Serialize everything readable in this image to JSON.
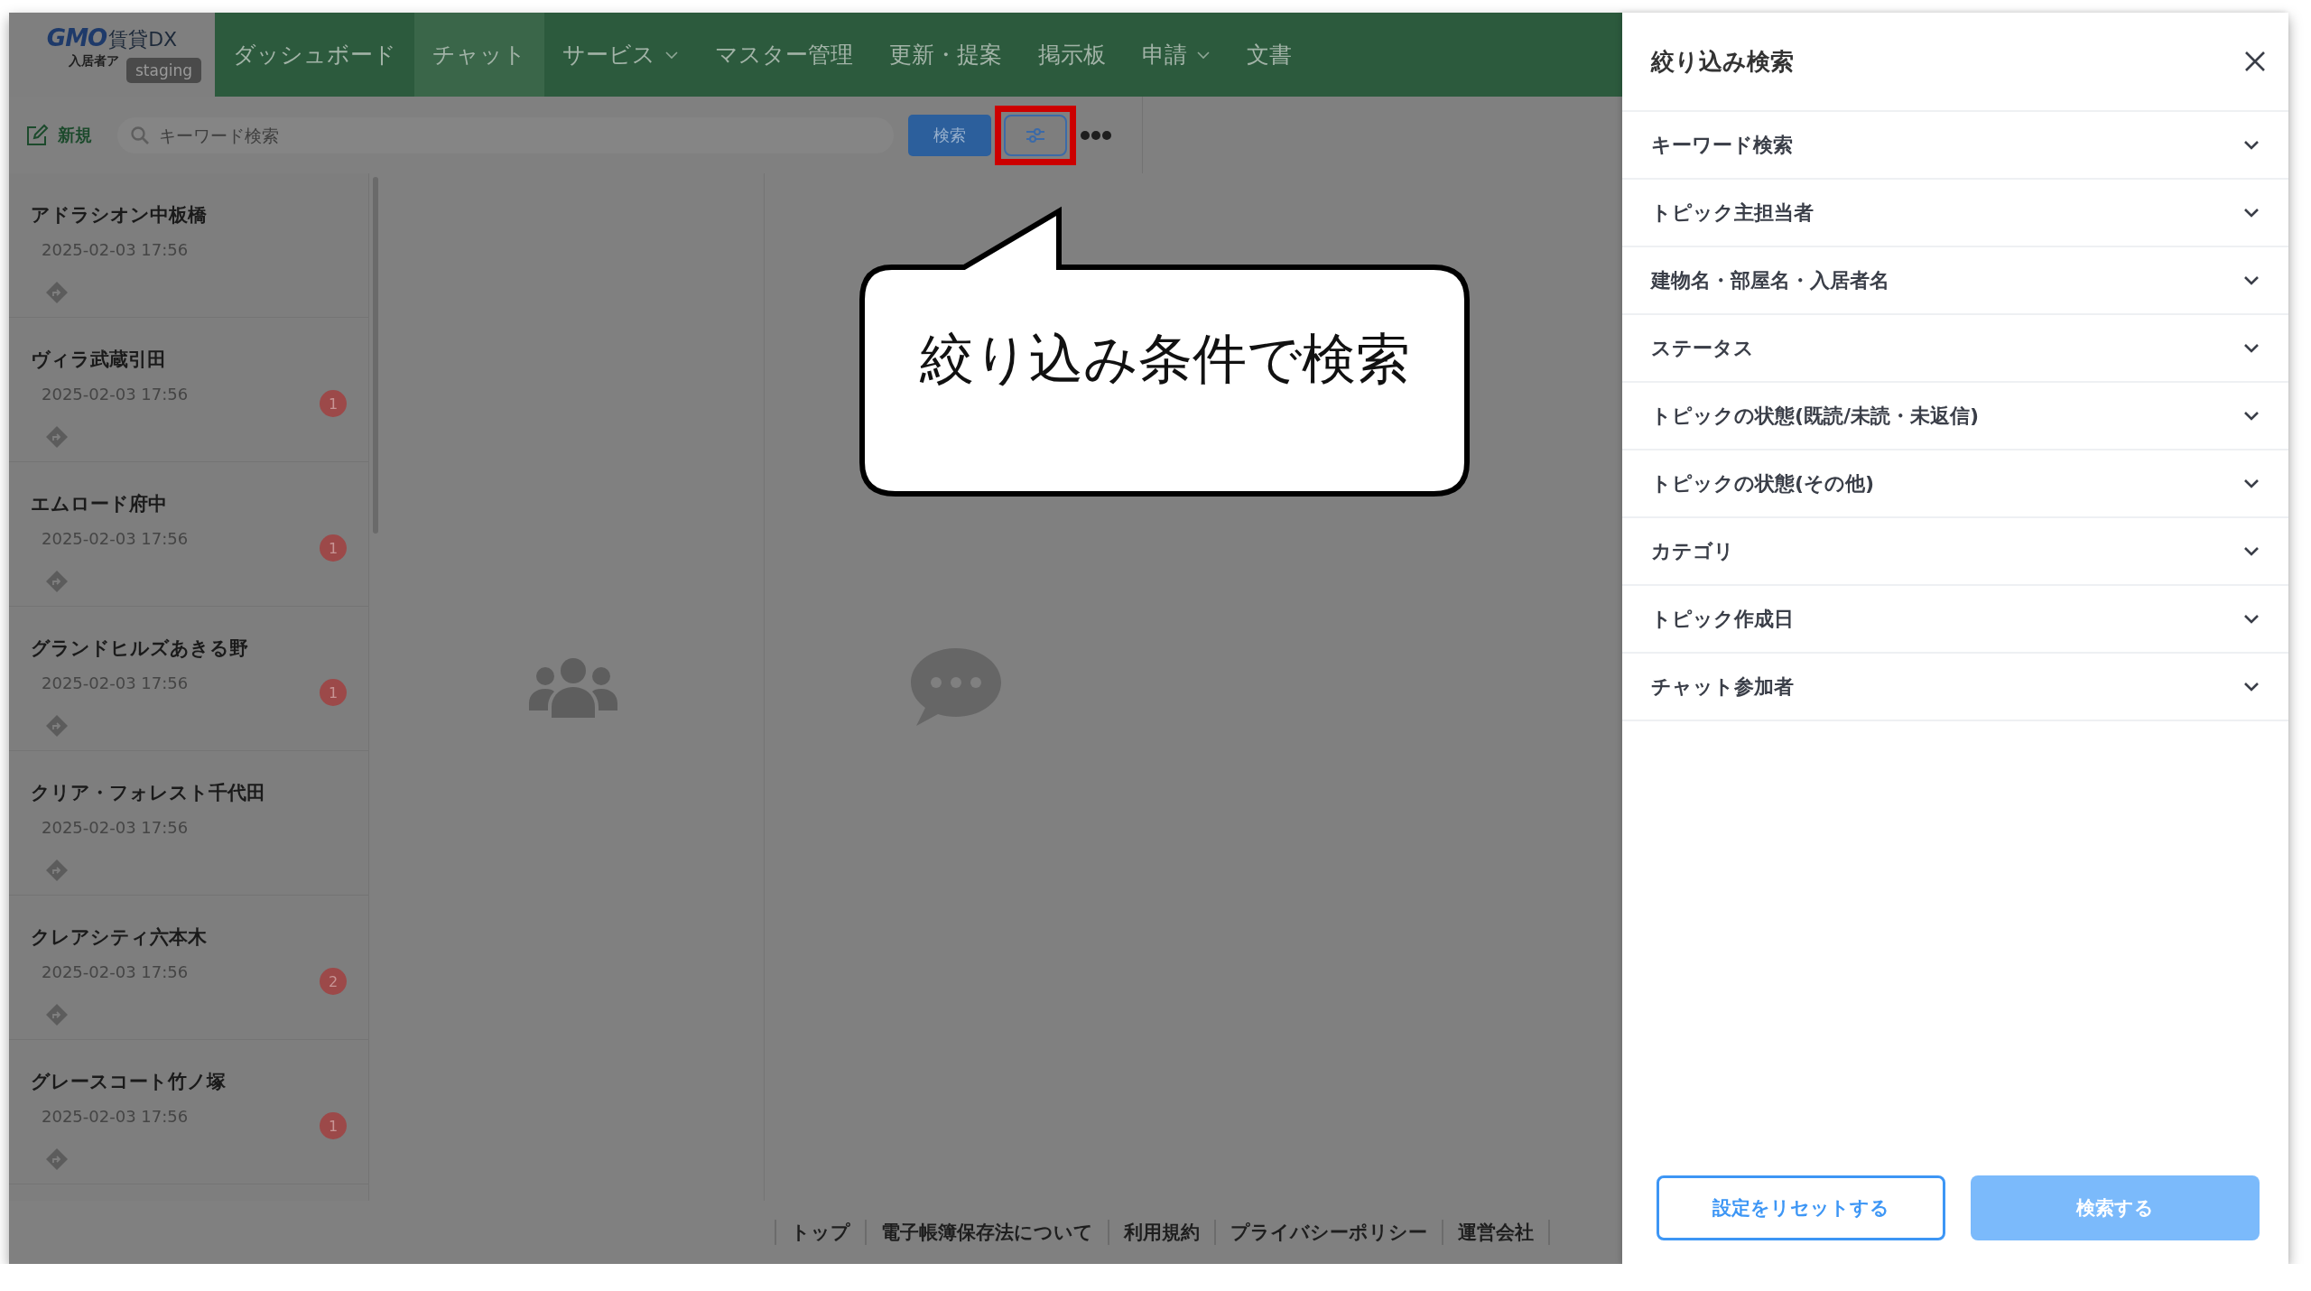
{
  "logo": {
    "brand": "GMO",
    "product": "賃貸DX",
    "subtitle": "入居者ア",
    "env_badge": "staging"
  },
  "nav": [
    {
      "label": "ダッシュボード",
      "selected": false,
      "dropdown": false
    },
    {
      "label": "チャット",
      "selected": true,
      "dropdown": false
    },
    {
      "label": "サービス",
      "selected": false,
      "dropdown": true
    },
    {
      "label": "マスター管理",
      "selected": false,
      "dropdown": false
    },
    {
      "label": "更新・提案",
      "selected": false,
      "dropdown": false
    },
    {
      "label": "掲示板",
      "selected": false,
      "dropdown": false
    },
    {
      "label": "申請",
      "selected": false,
      "dropdown": true
    },
    {
      "label": "文書",
      "selected": false,
      "dropdown": false
    }
  ],
  "toolbar": {
    "new_label": "新規",
    "search": {
      "placeholder": "キーワード検索"
    },
    "search_button": "検索",
    "filter_button": {
      "highlighted": true
    }
  },
  "topics": [
    {
      "name": "アドラシオン中板橋",
      "time": "2025-02-03 17:56"
    },
    {
      "name": "ヴィラ武蔵引田",
      "time": "2025-02-03 17:56",
      "badge": "1"
    },
    {
      "name": "エムロード府中",
      "time": "2025-02-03 17:56",
      "badge": "1"
    },
    {
      "name": "グランドヒルズあきる野",
      "time": "2025-02-03 17:56",
      "badge": "1"
    },
    {
      "name": "クリア・フォレスト千代田",
      "time": "2025-02-03 17:56"
    },
    {
      "name": "クレアシティ六本木",
      "time": "2025-02-03 17:56",
      "badge": "2"
    },
    {
      "name": "グレースコート竹ノ塚",
      "time": "2025-02-03 17:56",
      "badge": "1"
    }
  ],
  "footer": [
    "トップ",
    "電子帳簿保存法について",
    "利用規約",
    "プライバシーポリシー",
    "運営会社"
  ],
  "callout": "絞り込み条件で検索",
  "drawer": {
    "title": "絞り込み検索",
    "filters": [
      {
        "label": "キーワード検索",
        "expanded": false
      },
      {
        "label": "トピック主担当者",
        "expanded": false
      },
      {
        "label": "建物名・部屋名・入居者名",
        "expanded": false
      },
      {
        "label": "ステータス",
        "expanded": false
      },
      {
        "label": "トピックの状態(既読/未読・未返信)",
        "expanded": false
      },
      {
        "label": "トピックの状態(その他)",
        "expanded": false
      },
      {
        "label": "カテゴリ",
        "expanded": false
      },
      {
        "label": "トピック作成日",
        "expanded": false
      },
      {
        "label": "チャット参加者",
        "expanded": false
      }
    ],
    "reset_button": "設定をリセットする",
    "submit_button": "検索する"
  }
}
